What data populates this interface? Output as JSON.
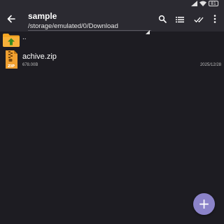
{
  "status_bar": {
    "battery_level": "81",
    "icons": [
      "signal-icon",
      "wifi-icon",
      "battery-icon"
    ]
  },
  "toolbar": {
    "title": "sample",
    "path": "/storage/emulated/0/Download",
    "icons": [
      "back-arrow-icon",
      "search-icon",
      "list-view-icon",
      "select-all-icon",
      "more-vert-icon"
    ]
  },
  "file_list": {
    "parent_label": "..",
    "items": [
      {
        "name": "achive.zip",
        "size": "678.00B",
        "date": "2025/12/28",
        "icon": "zip-file-icon"
      }
    ]
  },
  "fab": {
    "label": "+",
    "icon": "add-icon"
  },
  "colors": {
    "background": "#1d1c22",
    "toolbar": "#2b2a31",
    "folder": "#f5a623",
    "zip": "#f0a030",
    "fab": "#8b83c9"
  }
}
